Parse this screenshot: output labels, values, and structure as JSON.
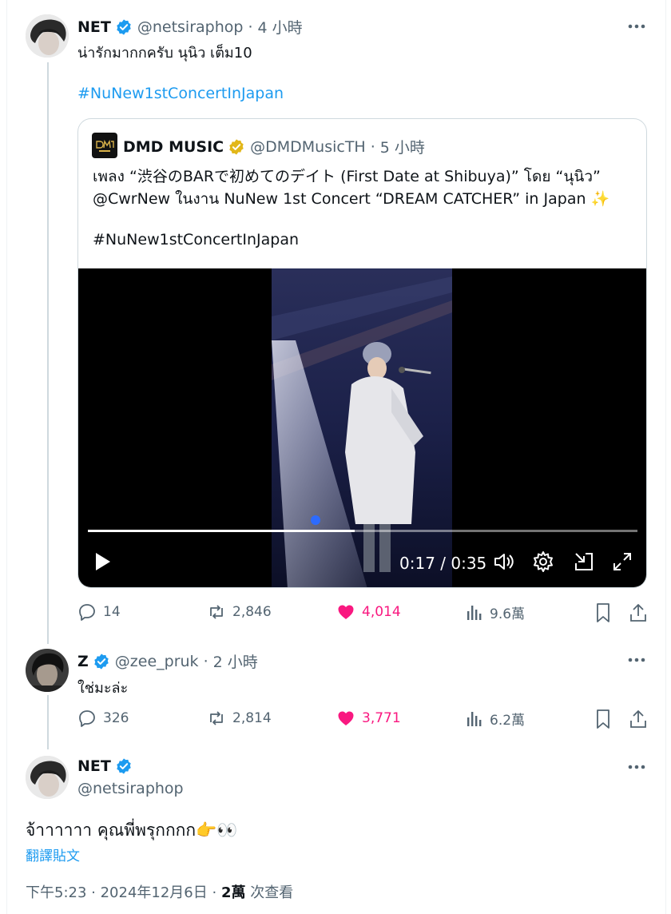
{
  "main_post": {
    "author_name": "NET",
    "author_handle": "@netsiraphop",
    "separator": "·",
    "time_ago": "4 小時",
    "text": "น่ารักมากกครับ นุนิว เต็ม10",
    "hashtag": "#NuNew1stConcertInJapan",
    "quoted": {
      "author_name": "DMD MUSIC",
      "author_handle": "@DMDMusicTH",
      "time_ago": "5 小時",
      "line1": "เพลง “渋谷のBARで初めてのデイト (First Date at Shibuya)” โดย “นุนิว”",
      "line2": "@CwrNew ในงาน NuNew 1st Concert “DREAM CATCHER” in Japan ✨",
      "hashtag": "#NuNew1stConcertInJapan",
      "video": {
        "current_time": "0:17",
        "duration": "0:35",
        "time_display": "0:17 / 0:35",
        "progress": 0.486
      }
    },
    "stats": {
      "replies": "14",
      "reposts": "2,846",
      "likes": "4,014",
      "views": "9.6萬"
    }
  },
  "reply": {
    "author_name": "Z",
    "author_handle": "@zee_pruk",
    "separator": "·",
    "time_ago": "2 小時",
    "text": "ใช่มะล่ะ",
    "stats": {
      "replies": "326",
      "reposts": "2,814",
      "likes": "3,771",
      "views": "6.2萬"
    }
  },
  "focus_post": {
    "author_name": "NET",
    "author_handle": "@netsiraphop",
    "text": "จ้าาาาาา คุณพี่พรุกกกก👉👀",
    "translate_link": "翻譯貼文",
    "timestamp": "下午5:23 · 2024年12月6日 ·",
    "views_count": "2萬",
    "views_label": "次查看"
  },
  "colors": {
    "accent": "#1d9bf0",
    "like": "#f91880",
    "verified_gold": "#e2b719",
    "muted": "#536471"
  },
  "icons": [
    "verified-badge-icon",
    "gold-verified-badge-icon",
    "more-icon",
    "reply-icon",
    "repost-icon",
    "like-icon",
    "views-icon",
    "bookmark-icon",
    "share-icon",
    "play-icon",
    "volume-icon",
    "settings-icon",
    "pip-icon",
    "fullscreen-icon"
  ]
}
